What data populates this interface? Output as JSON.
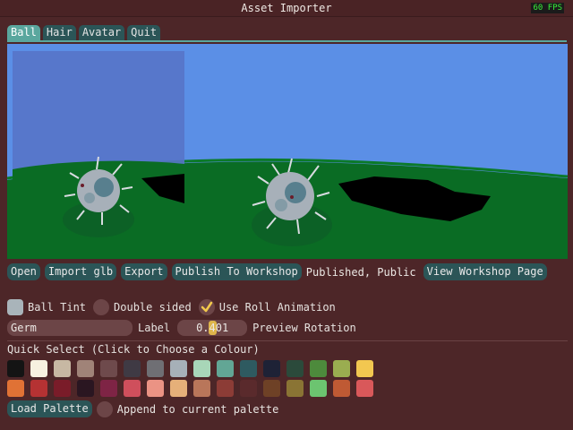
{
  "window": {
    "title": "Asset Importer",
    "fps": "60 FPS"
  },
  "tabs": [
    {
      "label": "Ball",
      "active": true
    },
    {
      "label": "Hair",
      "active": false
    },
    {
      "label": "Avatar",
      "active": false
    },
    {
      "label": "Quit",
      "active": false
    }
  ],
  "toolbar": {
    "open": "Open",
    "import_glb": "Import glb",
    "export": "Export",
    "publish": "Publish To Workshop",
    "status": "Published, Public",
    "view_page": "View Workshop Page"
  },
  "options": {
    "ball_tint_label": "Ball Tint",
    "ball_tint_color": "#a9b4ba",
    "double_sided_label": "Double sided",
    "double_sided": false,
    "roll_animation_label": "Use Roll Animation",
    "roll_animation": true
  },
  "label_row": {
    "label_value": "Germ",
    "label_caption": "Label",
    "rotation_value": "0.401",
    "rotation_fraction": 0.5,
    "rotation_caption": "Preview Rotation"
  },
  "quick_select": {
    "title": "Quick Select (Click to Choose a Colour)",
    "colors": [
      "#141414",
      "#f7f1e0",
      "#c7b8a3",
      "#a08378",
      "#6e4a4c",
      "#3f3a44",
      "#6f6f74",
      "#a6b0b8",
      "#a8d6b8",
      "#62a695",
      "#2e5a60",
      "#1e2236",
      "#2b4a3b",
      "#4d8a3c",
      "#9aad50",
      "#f2c750",
      "#e07235",
      "#b53233",
      "#7a1c29",
      "#2a1621",
      "#7e2445",
      "#cf4f5c",
      "#eb9384",
      "#e6b079",
      "#b9765a",
      "#8c3c36",
      "#5a2a2c",
      "#6e4126",
      "#8a7434",
      "#6cc470",
      "#bf5a34",
      "#d9585a"
    ]
  },
  "palette_actions": {
    "load_palette": "Load Palette",
    "append_label": "Append to current palette",
    "append": false
  }
}
